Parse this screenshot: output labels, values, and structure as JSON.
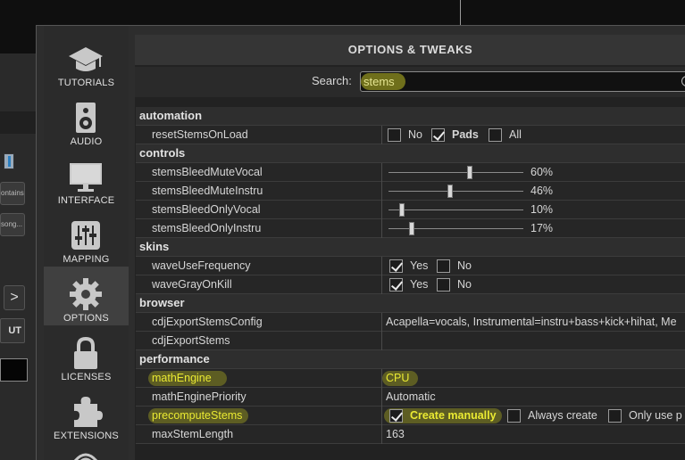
{
  "sidebar": {
    "items": [
      {
        "label": "TUTORIALS",
        "icon": "graduation-cap-icon",
        "active": false
      },
      {
        "label": "AUDIO",
        "icon": "speaker-icon",
        "active": false
      },
      {
        "label": "INTERFACE",
        "icon": "monitor-icon",
        "active": false
      },
      {
        "label": "MAPPING",
        "icon": "sliders-icon",
        "active": false
      },
      {
        "label": "OPTIONS",
        "icon": "gear-icon",
        "active": true
      },
      {
        "label": "LICENSES",
        "icon": "lock-icon",
        "active": false
      },
      {
        "label": "EXTENSIONS",
        "icon": "puzzle-icon",
        "active": false
      }
    ]
  },
  "background": {
    "chip1": "ontains...",
    "chip2": "song...",
    "arrow": ">",
    "button": "UT"
  },
  "header": {
    "title": "OPTIONS & TWEAKS"
  },
  "search": {
    "label": "Search:",
    "value": "stems"
  },
  "sections": {
    "automation": "automation",
    "controls": "controls",
    "skins": "skins",
    "browser": "browser",
    "performance": "performance"
  },
  "rows": {
    "resetStemsOnLoad": {
      "name": "resetStemsOnLoad",
      "opt1": "No",
      "opt2": "Pads",
      "opt3": "All"
    },
    "stemsBleedMuteVocal": {
      "name": "stemsBleedMuteVocal",
      "value": "60%",
      "level": 0.6
    },
    "stemsBleedMuteInstru": {
      "name": "stemsBleedMuteInstru",
      "value": "46%",
      "level": 0.46
    },
    "stemsBleedOnlyVocal": {
      "name": "stemsBleedOnlyVocal",
      "value": "10%",
      "level": 0.1
    },
    "stemsBleedOnlyInstru": {
      "name": "stemsBleedOnlyInstru",
      "value": "17%",
      "level": 0.17
    },
    "waveUseFrequency": {
      "name": "waveUseFrequency",
      "opt1": "Yes",
      "opt2": "No"
    },
    "waveGrayOnKill": {
      "name": "waveGrayOnKill",
      "opt1": "Yes",
      "opt2": "No"
    },
    "cdjExportStemsConfig": {
      "name": "cdjExportStemsConfig",
      "value": "Acapella=vocals, Instrumental=instru+bass+kick+hihat, Me"
    },
    "cdjExportStems": {
      "name": "cdjExportStems",
      "value": ""
    },
    "mathEngine": {
      "name": "mathEngine",
      "value": "CPU"
    },
    "mathEnginePriority": {
      "name": "mathEnginePriority",
      "value": "Automatic"
    },
    "precomputeStems": {
      "name": "precomputeStems",
      "opt1": "Create manually",
      "opt2": "Always create",
      "opt3": "Only use p"
    },
    "maxStemLength": {
      "name": "maxStemLength",
      "value": "163"
    }
  },
  "colors": {
    "highlight": "#eaea32",
    "accent_bg": "#404040"
  }
}
